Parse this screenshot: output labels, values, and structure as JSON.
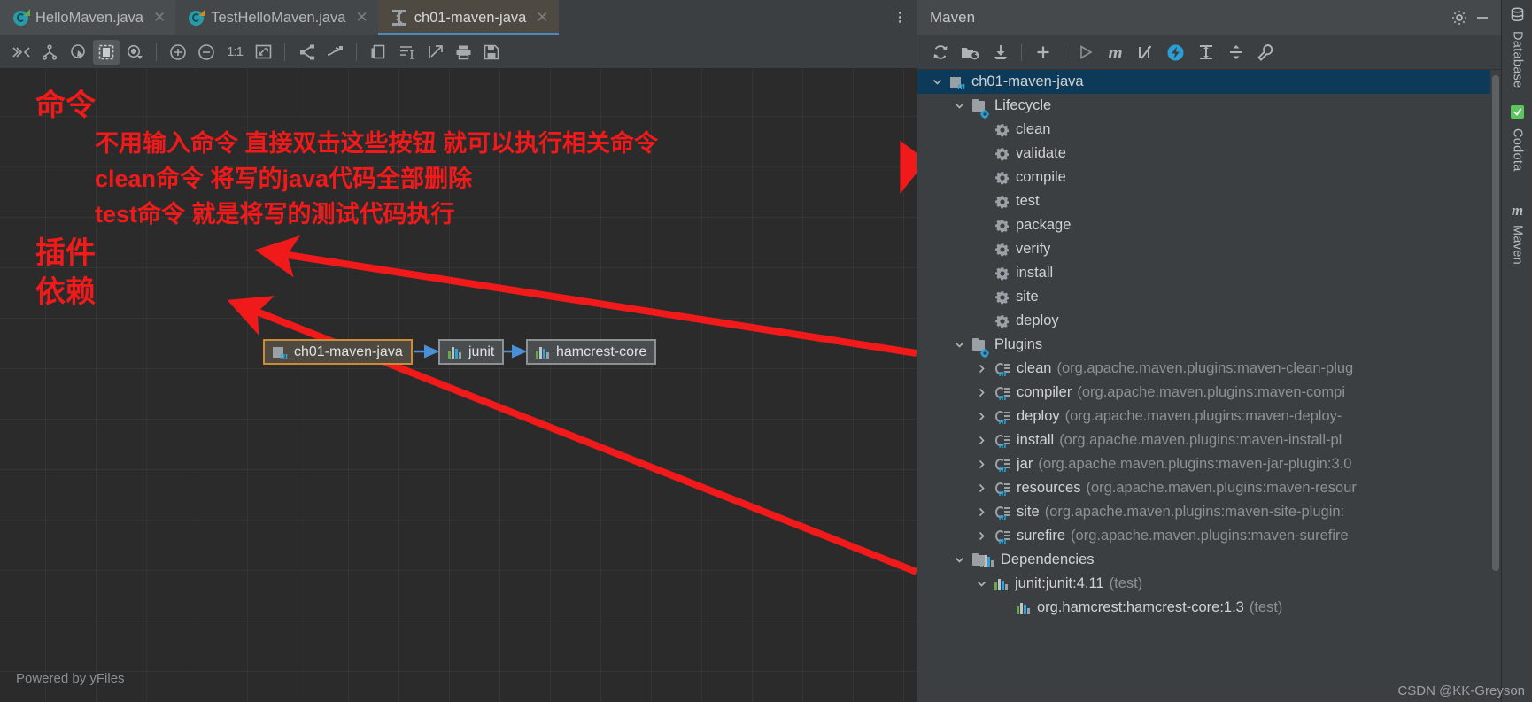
{
  "editor": {
    "tabs": [
      {
        "label": "HelloMaven.java",
        "icon": "java-class-icon",
        "active": false
      },
      {
        "label": "TestHelloMaven.java",
        "icon": "java-test-class-icon",
        "active": false
      },
      {
        "label": "ch01-maven-java",
        "icon": "dependency-diagram-icon",
        "active": true
      }
    ],
    "tab_overflow_label": "⋮",
    "toolbar": [
      {
        "name": "expand-collapse-icon",
        "glyph": "»«"
      },
      {
        "name": "layout-hierarchic-icon",
        "glyph": "⅄"
      },
      {
        "name": "select-mode-icon",
        "glyph": "◎"
      },
      {
        "name": "fit-content-icon",
        "glyph": "▣"
      },
      {
        "name": "visibility-icon",
        "glyph": "◉"
      },
      {
        "name": "zoom-in-icon",
        "glyph": "⊕"
      },
      {
        "name": "zoom-out-icon",
        "glyph": "⊖"
      },
      {
        "name": "actual-size-icon",
        "glyph": "1:1"
      },
      {
        "name": "fit-screen-icon",
        "glyph": "⛶"
      },
      {
        "name": "show-paths-icon",
        "glyph": "≺"
      },
      {
        "name": "show-neighbours-icon",
        "glyph": "↦"
      },
      {
        "name": "copy-icon",
        "glyph": "⎘"
      },
      {
        "name": "edit-node-icon",
        "glyph": "≡"
      },
      {
        "name": "export-icon",
        "glyph": "↗"
      },
      {
        "name": "print-icon",
        "glyph": "⎙"
      },
      {
        "name": "save-icon",
        "glyph": "Ὃe"
      }
    ],
    "powered_by": "Powered by yFiles"
  },
  "annotations": {
    "command_label": "命令",
    "line1": "不用输入命令 直接双击这些按钮 就可以执行相关命令",
    "line2": "clean命令 将写的java代码全部删除",
    "line3": "test命令 就是将写的测试代码执行",
    "plugin_label": "插件",
    "dependency_label": "依赖",
    "color": "#f01a1a"
  },
  "graph": {
    "nodes": [
      {
        "label": "ch01-maven-java",
        "icon": "maven-module-icon",
        "kind": "root"
      },
      {
        "label": "junit",
        "icon": "library-icon",
        "kind": "dep"
      },
      {
        "label": "hamcrest-core",
        "icon": "library-icon",
        "kind": "dep"
      }
    ]
  },
  "maven": {
    "title": "Maven",
    "settings_label": "gear-icon",
    "minimize_label": "—",
    "toolbar": [
      {
        "name": "reload-all-maven-projects-icon",
        "glyph": "⟳"
      },
      {
        "name": "generate-sources-icon",
        "glyph": "὜0"
      },
      {
        "name": "download-sources-icon",
        "glyph": "⤓"
      },
      {
        "name": "add-maven-project-icon",
        "glyph": "+"
      },
      {
        "name": "run-icon",
        "glyph": "▶"
      },
      {
        "name": "execute-maven-goal-icon",
        "glyph": "m"
      },
      {
        "name": "toggle-skip-tests-icon",
        "glyph": "⫻"
      },
      {
        "name": "toggle-offline-mode-icon",
        "glyph": "⚡"
      },
      {
        "name": "expand-all-icon",
        "glyph": "⤓"
      },
      {
        "name": "collapse-all-icon",
        "glyph": "⤒"
      },
      {
        "name": "maven-settings-icon",
        "glyph": "ὒ7"
      }
    ],
    "tree": [
      {
        "indent": 0,
        "arrow": "down",
        "icon": "maven-module-icon",
        "label": "ch01-maven-java",
        "dim": "",
        "selected": true
      },
      {
        "indent": 1,
        "arrow": "down",
        "icon": "folder-gear-icon",
        "label": "Lifecycle",
        "dim": "",
        "selected": false
      },
      {
        "indent": 2,
        "arrow": "none",
        "icon": "gear-icon",
        "label": "clean",
        "dim": "",
        "selected": false
      },
      {
        "indent": 2,
        "arrow": "none",
        "icon": "gear-icon",
        "label": "validate",
        "dim": "",
        "selected": false
      },
      {
        "indent": 2,
        "arrow": "none",
        "icon": "gear-icon",
        "label": "compile",
        "dim": "",
        "selected": false
      },
      {
        "indent": 2,
        "arrow": "none",
        "icon": "gear-icon",
        "label": "test",
        "dim": "",
        "selected": false
      },
      {
        "indent": 2,
        "arrow": "none",
        "icon": "gear-icon",
        "label": "package",
        "dim": "",
        "selected": false
      },
      {
        "indent": 2,
        "arrow": "none",
        "icon": "gear-icon",
        "label": "verify",
        "dim": "",
        "selected": false
      },
      {
        "indent": 2,
        "arrow": "none",
        "icon": "gear-icon",
        "label": "install",
        "dim": "",
        "selected": false
      },
      {
        "indent": 2,
        "arrow": "none",
        "icon": "gear-icon",
        "label": "site",
        "dim": "",
        "selected": false
      },
      {
        "indent": 2,
        "arrow": "none",
        "icon": "gear-icon",
        "label": "deploy",
        "dim": "",
        "selected": false
      },
      {
        "indent": 1,
        "arrow": "down",
        "icon": "folder-gear-icon",
        "label": "Plugins",
        "dim": "",
        "selected": false
      },
      {
        "indent": 2,
        "arrow": "right",
        "icon": "plugin-icon",
        "label": "clean",
        "dim": "(org.apache.maven.plugins:maven-clean-plug",
        "selected": false
      },
      {
        "indent": 2,
        "arrow": "right",
        "icon": "plugin-icon",
        "label": "compiler",
        "dim": "(org.apache.maven.plugins:maven-compi",
        "selected": false
      },
      {
        "indent": 2,
        "arrow": "right",
        "icon": "plugin-icon",
        "label": "deploy",
        "dim": "(org.apache.maven.plugins:maven-deploy-",
        "selected": false
      },
      {
        "indent": 2,
        "arrow": "right",
        "icon": "plugin-icon",
        "label": "install",
        "dim": "(org.apache.maven.plugins:maven-install-pl",
        "selected": false
      },
      {
        "indent": 2,
        "arrow": "right",
        "icon": "plugin-icon",
        "label": "jar",
        "dim": "(org.apache.maven.plugins:maven-jar-plugin:3.0",
        "selected": false
      },
      {
        "indent": 2,
        "arrow": "right",
        "icon": "plugin-icon",
        "label": "resources",
        "dim": "(org.apache.maven.plugins:maven-resour",
        "selected": false
      },
      {
        "indent": 2,
        "arrow": "right",
        "icon": "plugin-icon",
        "label": "site",
        "dim": "(org.apache.maven.plugins:maven-site-plugin:",
        "selected": false
      },
      {
        "indent": 2,
        "arrow": "right",
        "icon": "plugin-icon",
        "label": "surefire",
        "dim": "(org.apache.maven.plugins:maven-surefire",
        "selected": false
      },
      {
        "indent": 1,
        "arrow": "down",
        "icon": "dependencies-icon",
        "label": "Dependencies",
        "dim": "",
        "selected": false
      },
      {
        "indent": 2,
        "arrow": "down",
        "icon": "library-icon",
        "label": "junit:junit:4.11",
        "dim": "(test)",
        "selected": false
      },
      {
        "indent": 3,
        "arrow": "none",
        "icon": "library-icon",
        "label": "org.hamcrest:hamcrest-core:1.3",
        "dim": "(test)",
        "selected": false
      }
    ]
  },
  "right_sidebar": [
    {
      "label": "Database",
      "icon": "database-icon"
    },
    {
      "label": "Codota",
      "icon": "codota-icon"
    },
    {
      "label": "Maven",
      "icon": "maven-icon"
    }
  ],
  "watermark": "CSDN @KK-Greyson"
}
